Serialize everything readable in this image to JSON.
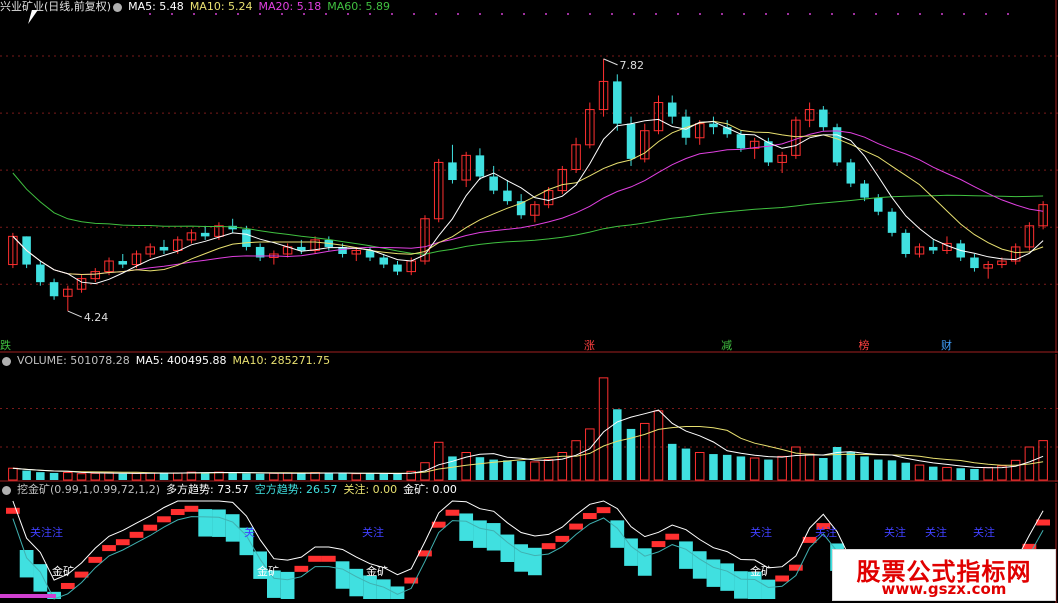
{
  "main": {
    "title": "兴业矿业(日线,前复权)",
    "ma_labels": [
      {
        "text": "MA5: 5.48",
        "color": "#ffffff"
      },
      {
        "text": "MA10: 5.24",
        "color": "#e8e070"
      },
      {
        "text": "MA20: 5.18",
        "color": "#e040e0"
      },
      {
        "text": "MA60: 5.89",
        "color": "#40c040"
      }
    ],
    "high_label": "7.82",
    "low_label": "4.24",
    "markers": [
      {
        "text": "跌",
        "color": "#40c040"
      },
      {
        "text": "涨",
        "color": "#ff4040"
      },
      {
        "text": "减",
        "color": "#40c040"
      },
      {
        "text": "榜",
        "color": "#ff4040"
      },
      {
        "text": "财",
        "color": "#40a0ff"
      }
    ]
  },
  "volume": {
    "labels": [
      {
        "text": "VOLUME: 501078.28",
        "color": "#c0c0c0"
      },
      {
        "text": "MA5: 400495.88",
        "color": "#ffffff"
      },
      {
        "text": "MA10: 285271.75",
        "color": "#e8e070"
      }
    ]
  },
  "indicator": {
    "labels": [
      {
        "text": "挖金矿(0.99,1,0.99,72,1,2)",
        "color": "#c0c0c0"
      },
      {
        "text": "多方趋势: 73.57",
        "color": "#ffffff"
      },
      {
        "text": "空方趋势: 26.57",
        "color": "#40e0e0"
      },
      {
        "text": "关注: 0.00",
        "color": "#e8e070"
      },
      {
        "text": "金矿: 0.00",
        "color": "#ffffff"
      }
    ],
    "guanzhu_labels": [
      "关注注",
      "关",
      "关注",
      "关注",
      "关注",
      "关注",
      "关注",
      "关注"
    ],
    "jinkuang_labels": [
      "金矿",
      "金矿",
      "金矿",
      "金矿",
      "金矿"
    ]
  },
  "watermark": {
    "line1": "股票公式指标网",
    "line2": "www.gszx.com"
  },
  "colors": {
    "up": "#ff3030",
    "down": "#40e0e0",
    "ma5": "#ffffff",
    "ma10": "#e8e070",
    "ma20": "#e040e0",
    "ma60": "#40c040",
    "grid": "#7a1a1a",
    "divider": "#a02020"
  },
  "chart_data": [
    {
      "type": "candlestick",
      "title": "兴业矿业(日线,前复权)",
      "ylim": [
        3.9,
        8.4
      ],
      "annotated_high": 7.82,
      "annotated_low": 4.24,
      "ma_latest": {
        "MA5": 5.48,
        "MA10": 5.24,
        "MA20": 5.18,
        "MA60": 5.89
      },
      "ohlc": [
        [
          4.9,
          5.35,
          4.85,
          5.3
        ],
        [
          5.3,
          5.3,
          4.85,
          4.9
        ],
        [
          4.9,
          4.95,
          4.6,
          4.65
        ],
        [
          4.65,
          4.7,
          4.4,
          4.45
        ],
        [
          4.45,
          4.6,
          4.24,
          4.55
        ],
        [
          4.55,
          4.75,
          4.5,
          4.7
        ],
        [
          4.7,
          4.85,
          4.65,
          4.8
        ],
        [
          4.8,
          5.0,
          4.75,
          4.95
        ],
        [
          4.95,
          5.05,
          4.85,
          4.9
        ],
        [
          4.9,
          5.1,
          4.85,
          5.05
        ],
        [
          5.05,
          5.2,
          5.0,
          5.15
        ],
        [
          5.15,
          5.25,
          5.05,
          5.1
        ],
        [
          5.1,
          5.3,
          5.05,
          5.25
        ],
        [
          5.25,
          5.4,
          5.2,
          5.35
        ],
        [
          5.35,
          5.45,
          5.25,
          5.3
        ],
        [
          5.3,
          5.5,
          5.25,
          5.45
        ],
        [
          5.45,
          5.55,
          5.35,
          5.4
        ],
        [
          5.4,
          5.45,
          5.1,
          5.15
        ],
        [
          5.15,
          5.2,
          4.95,
          5.0
        ],
        [
          5.0,
          5.1,
          4.9,
          5.05
        ],
        [
          5.05,
          5.2,
          5.0,
          5.15
        ],
        [
          5.15,
          5.25,
          5.05,
          5.1
        ],
        [
          5.1,
          5.3,
          5.05,
          5.25
        ],
        [
          5.25,
          5.3,
          5.1,
          5.15
        ],
        [
          5.15,
          5.2,
          5.0,
          5.05
        ],
        [
          5.05,
          5.15,
          4.95,
          5.1
        ],
        [
          5.1,
          5.15,
          4.95,
          5.0
        ],
        [
          5.0,
          5.05,
          4.85,
          4.9
        ],
        [
          4.9,
          4.95,
          4.75,
          4.8
        ],
        [
          4.8,
          5.0,
          4.75,
          4.95
        ],
        [
          4.95,
          5.6,
          4.9,
          5.55
        ],
        [
          5.55,
          6.4,
          5.5,
          6.35
        ],
        [
          6.35,
          6.6,
          6.05,
          6.1
        ],
        [
          6.1,
          6.5,
          6.0,
          6.45
        ],
        [
          6.45,
          6.55,
          6.1,
          6.15
        ],
        [
          6.15,
          6.3,
          5.9,
          5.95
        ],
        [
          5.95,
          6.1,
          5.75,
          5.8
        ],
        [
          5.8,
          5.9,
          5.55,
          5.6
        ],
        [
          5.6,
          5.8,
          5.5,
          5.75
        ],
        [
          5.75,
          6.0,
          5.7,
          5.95
        ],
        [
          5.95,
          6.3,
          5.9,
          6.25
        ],
        [
          6.25,
          6.7,
          6.2,
          6.6
        ],
        [
          6.6,
          7.2,
          6.55,
          7.1
        ],
        [
          7.1,
          7.82,
          7.0,
          7.5
        ],
        [
          7.5,
          7.6,
          6.8,
          6.9
        ],
        [
          6.9,
          7.0,
          6.3,
          6.4
        ],
        [
          6.4,
          6.9,
          6.35,
          6.8
        ],
        [
          6.8,
          7.3,
          6.75,
          7.2
        ],
        [
          7.2,
          7.3,
          6.9,
          7.0
        ],
        [
          7.0,
          7.1,
          6.6,
          6.7
        ],
        [
          6.7,
          6.95,
          6.6,
          6.9
        ],
        [
          6.9,
          7.0,
          6.75,
          6.85
        ],
        [
          6.85,
          6.95,
          6.7,
          6.75
        ],
        [
          6.75,
          6.8,
          6.5,
          6.55
        ],
        [
          6.55,
          6.7,
          6.4,
          6.65
        ],
        [
          6.65,
          6.7,
          6.3,
          6.35
        ],
        [
          6.35,
          6.5,
          6.2,
          6.45
        ],
        [
          6.45,
          7.0,
          6.4,
          6.95
        ],
        [
          6.95,
          7.2,
          6.85,
          7.1
        ],
        [
          7.1,
          7.15,
          6.8,
          6.85
        ],
        [
          6.85,
          6.9,
          6.3,
          6.35
        ],
        [
          6.35,
          6.4,
          6.0,
          6.05
        ],
        [
          6.05,
          6.1,
          5.8,
          5.85
        ],
        [
          5.85,
          5.9,
          5.6,
          5.65
        ],
        [
          5.65,
          5.7,
          5.3,
          5.35
        ],
        [
          5.35,
          5.4,
          5.0,
          5.05
        ],
        [
          5.05,
          5.2,
          5.0,
          5.15
        ],
        [
          5.15,
          5.25,
          5.05,
          5.1
        ],
        [
          5.1,
          5.3,
          5.05,
          5.2
        ],
        [
          5.2,
          5.25,
          4.95,
          5.0
        ],
        [
          5.0,
          5.05,
          4.8,
          4.85
        ],
        [
          4.85,
          4.95,
          4.7,
          4.9
        ],
        [
          4.9,
          5.0,
          4.85,
          4.95
        ],
        [
          4.95,
          5.2,
          4.9,
          5.15
        ],
        [
          5.15,
          5.5,
          5.1,
          5.45
        ],
        [
          5.45,
          5.8,
          5.4,
          5.75
        ]
      ]
    },
    {
      "type": "bar",
      "title": "VOLUME",
      "latest": {
        "VOLUME": 501078.28,
        "MA5": 400495.88,
        "MA10": 285271.75
      },
      "values": [
        150000,
        120000,
        100000,
        90000,
        95000,
        80000,
        85000,
        90000,
        80000,
        85000,
        90000,
        95000,
        90000,
        100000,
        95000,
        100000,
        90000,
        85000,
        80000,
        85000,
        90000,
        85000,
        95000,
        90000,
        85000,
        80000,
        85000,
        80000,
        80000,
        110000,
        220000,
        480000,
        300000,
        350000,
        290000,
        260000,
        250000,
        240000,
        230000,
        260000,
        350000,
        500000,
        650000,
        1300000,
        900000,
        650000,
        720000,
        880000,
        460000,
        400000,
        350000,
        330000,
        320000,
        300000,
        280000,
        260000,
        300000,
        420000,
        330000,
        280000,
        420000,
        360000,
        300000,
        260000,
        250000,
        220000,
        190000,
        170000,
        160000,
        150000,
        140000,
        160000,
        180000,
        250000,
        420000,
        501078
      ]
    },
    {
      "type": "area",
      "title": "挖金矿(0.99,1,0.99,72,1,2)",
      "latest": {
        "多方趋势": 73.57,
        "空方趋势": 26.57,
        "关注": 0.0,
        "金矿": 0.0
      }
    }
  ]
}
